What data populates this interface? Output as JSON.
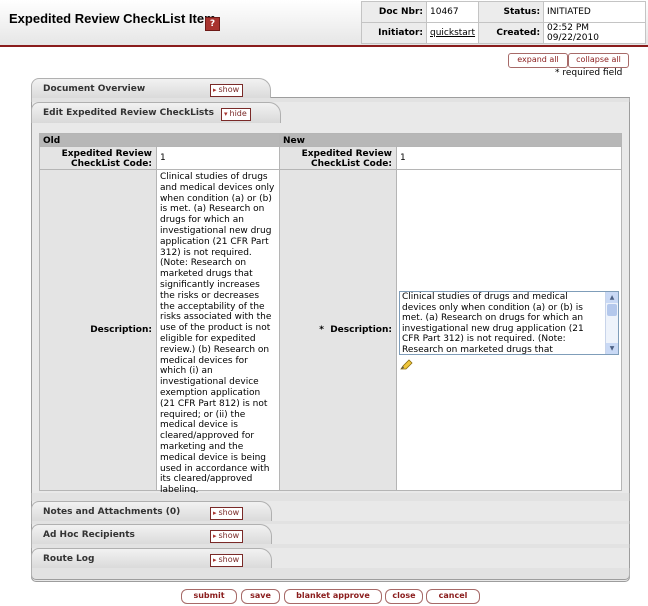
{
  "header": {
    "title": "Expedited Review CheckList Item",
    "help_icon_glyph": "?",
    "doc_nbr_label": "Doc Nbr:",
    "doc_nbr": "10467",
    "status_label": "Status:",
    "status": "INITIATED",
    "initiator_label": "Initiator:",
    "initiator": "quickstart",
    "created_label": "Created:",
    "created": "02:52 PM 09/22/2010"
  },
  "actions": {
    "expand_all": "expand all",
    "collapse_all": "collapse all",
    "required_note": "* required field"
  },
  "tabs": {
    "document_overview": {
      "label": "Document Overview",
      "button": "show"
    },
    "edit": {
      "label": "Edit Expedited Review CheckLists",
      "button": "hide"
    },
    "notes": {
      "label": "Notes and Attachments (0)",
      "button": "show"
    },
    "adhoc": {
      "label": "Ad Hoc Recipients",
      "button": "show"
    },
    "route_log": {
      "label": "Route Log",
      "button": "show"
    }
  },
  "grid": {
    "old_header": "Old",
    "new_header": "New",
    "code_label": "Expedited Review CheckList Code:",
    "old_code": "1",
    "new_code": "1",
    "desc_label": "Description:",
    "desc_required_marker": "*",
    "old_description": "Clinical studies of drugs and medical devices only when condition (a) or (b) is met. (a) Research on drugs for which an investigational new drug application (21 CFR Part 312) is not required. (Note: Research on marketed drugs that significantly increases the risks or decreases the acceptability of the risks associated with the use of the product is not eligible for expedited review.) (b) Research on medical devices for which (i) an investigational device exemption application (21 CFR Part 812) is not required; or (ii) the medical device is cleared/approved for marketing and the medical device is being used in accordance with its cleared/approved labeling.",
    "new_description_visible": "Clinical studies of drugs and medical devices only when condition (a) or (b) is met. (a) Research on drugs for which an investigational new drug application (21 CFR Part 312) is not required.  (Note: Research on marketed drugs that"
  },
  "buttons": {
    "submit": "submit",
    "save": "save",
    "blanket_approve": "blanket approve",
    "close": "close",
    "cancel": "cancel"
  },
  "colors": {
    "accent": "#8a1c1c",
    "header_grid": "#b7b7b7",
    "label_bg": "#e4e4e4"
  },
  "icons": [
    "help-icon",
    "pencil-icon",
    "show-arrow-icon",
    "hide-arrow-icon"
  ]
}
